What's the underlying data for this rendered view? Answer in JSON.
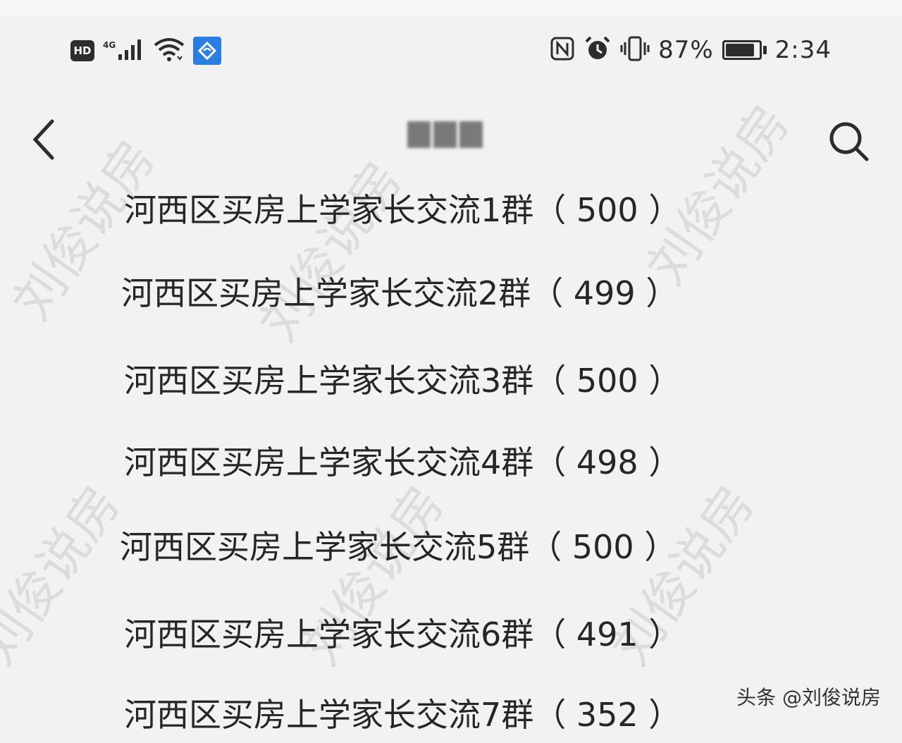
{
  "status_bar": {
    "hd_label": "HD",
    "network_label": "4G",
    "signal_icon": "signal-bars-icon",
    "wifi_icon": "wifi-icon",
    "vpn_icon": "vpn-icon",
    "nfc_icon": "nfc-icon",
    "alarm_icon": "alarm-icon",
    "vibrate_icon": "vibrate-icon",
    "battery_percent": "87%",
    "battery_level": 0.87,
    "time": "2:34"
  },
  "nav": {
    "back_icon": "chevron-left-icon",
    "search_icon": "search-icon"
  },
  "groups": [
    {
      "name": "河西区买房上学家长交流1群",
      "count": "（ 500 ）"
    },
    {
      "name": "河西区买房上学家长交流2群",
      "count": "（ 499 ）"
    },
    {
      "name": "河西区买房上学家长交流3群",
      "count": "（ 500 ）"
    },
    {
      "name": "河西区买房上学家长交流4群",
      "count": "（ 498 ）"
    },
    {
      "name": "河西区买房上学家长交流5群",
      "count": "（ 500 ）"
    },
    {
      "name": "河西区买房上学家长交流6群",
      "count": "（ 491 ）"
    },
    {
      "name": "河西区买房上学家长交流7群",
      "count": "（ 352 ）"
    }
  ],
  "watermark_text": "刘俊说房",
  "source_label": "头条 @刘俊说房",
  "colors": {
    "vpn_blue": "#2a7de1",
    "text": "#262626",
    "background": "#f2f2f2"
  }
}
